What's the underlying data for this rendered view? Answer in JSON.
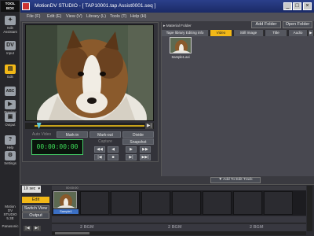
{
  "window": {
    "title": "MotionDV STUDIO - [ TAP10001.tap   Assist0001.seq ]",
    "controls": [
      "_",
      "□",
      "×"
    ]
  },
  "menu": [
    "File (F)",
    "Edit (E)",
    "View (V)",
    "Library (L)",
    "Tools (T)",
    "Help (H)"
  ],
  "toolbox": {
    "logo_line1": "TOOL",
    "logo_line2": "BOX",
    "tools": [
      {
        "label": "Edit Assistant",
        "icon": "assistant-icon",
        "glyph": "✦"
      },
      {
        "label": "Input",
        "icon": "dv-input-icon",
        "glyph": "DV"
      },
      {
        "label": "Edit",
        "icon": "edit-icon",
        "glyph": "▤"
      },
      {
        "label": "ABC",
        "icon": "title-abc-icon",
        "glyph": "ABC"
      },
      {
        "label": "Preview",
        "icon": "preview-icon",
        "glyph": "▶"
      },
      {
        "label": "Output",
        "icon": "output-icon",
        "glyph": "▣"
      },
      {
        "label": "Help",
        "icon": "help-icon",
        "glyph": "?"
      },
      {
        "label": "Settings",
        "icon": "settings-icon",
        "glyph": "⚙"
      }
    ],
    "brand_line1": "Motion",
    "brand_line2": "DV",
    "brand_line3": "STUDIO",
    "brand_line4": "5.3E",
    "maker": "Panasonic"
  },
  "preview": {
    "subject": "sheltie-dog-video-frame",
    "buttons_row1": [
      "Auto Video",
      "Mark-in",
      "Mark-out",
      "Divide"
    ],
    "labels_row2": [
      "Capture",
      "Snapshot"
    ],
    "timecode": "00:00:00:00",
    "transport_row1": [
      "◀◀",
      "◀",
      "▶",
      "▶▶"
    ],
    "transport_row2": [
      "|◀",
      "■",
      "▶|",
      "▶▶|"
    ],
    "scrub_position": 0.04
  },
  "library": {
    "folder_path": "Material Folder",
    "add_folder": "Add Folder",
    "open_folder": "Open Folder",
    "tabs": [
      "Tape library Editing info",
      "Video",
      "Still Image",
      "Title",
      "Audio"
    ],
    "active_tab": "Video",
    "items": [
      {
        "caption": "Sample1.avi"
      }
    ]
  },
  "add_to_edit_track": "Add To Edit Track",
  "timeline": {
    "zoom": "1X sec",
    "edit_button": "Edit",
    "switch_view": "Switch View",
    "output": "Output",
    "ruler_time": "00:00:00",
    "clip_label": "Sample1",
    "bgm_labels": [
      "2 BGM",
      "2 BGM",
      "2 BGM"
    ],
    "colors": {
      "accent": "#f2b817",
      "timecode": "#3fe05a",
      "clip": "#3b6fc4"
    }
  }
}
